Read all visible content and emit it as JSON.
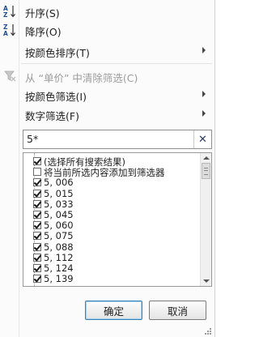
{
  "menu": {
    "sort_asc": {
      "label": "升序(S)",
      "icon": "sort-asc-icon"
    },
    "sort_desc": {
      "label": "降序(O)",
      "icon": "sort-desc-icon"
    },
    "sort_by_color": {
      "label": "按颜色排序(T)"
    },
    "clear_filter": {
      "label": "从 “单价” 中清除筛选(C)",
      "icon": "clear-filter-icon"
    },
    "filter_by_color": {
      "label": "按颜色筛选(I)"
    },
    "number_filter": {
      "label": "数字筛选(F)"
    }
  },
  "search": {
    "value": "5*",
    "clear_icon": "close-icon"
  },
  "list": {
    "select_all": {
      "label": "(选择所有搜索结果)",
      "checked": true
    },
    "add_to_filter": {
      "label": "将当前所选内容添加到筛选器",
      "checked": false
    },
    "items": [
      {
        "label": "5, 006",
        "checked": true
      },
      {
        "label": "5, 015",
        "checked": true
      },
      {
        "label": "5, 033",
        "checked": true
      },
      {
        "label": "5, 045",
        "checked": true
      },
      {
        "label": "5, 060",
        "checked": true
      },
      {
        "label": "5, 075",
        "checked": true
      },
      {
        "label": "5, 088",
        "checked": true
      },
      {
        "label": "5, 112",
        "checked": true
      },
      {
        "label": "5, 124",
        "checked": true
      },
      {
        "label": "5, 139",
        "checked": true
      }
    ]
  },
  "buttons": {
    "ok": "确定",
    "cancel": "取消"
  }
}
